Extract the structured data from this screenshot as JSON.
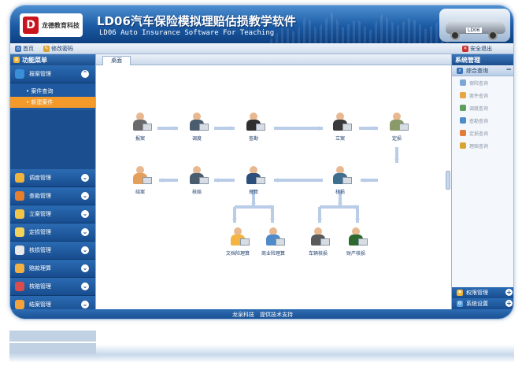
{
  "header": {
    "logo_text": "龙德教育科技",
    "title": "LD06汽车保险模拟理赔估损教学软件",
    "subtitle": "LD06 Auto Insurance Software For Teaching"
  },
  "topbar": {
    "home": "首页",
    "change_password": "修改密码",
    "logout": "安全退出"
  },
  "sidebar": {
    "header": "功能菜单",
    "expanded_group": {
      "label": "报案管理",
      "sub_items": [
        {
          "label": "案件查询",
          "active": false
        },
        {
          "label": "新建案件",
          "active": true
        }
      ]
    },
    "groups": [
      {
        "label": "调度管理",
        "icon": "dispatch-icon",
        "color": "#f0b43c"
      },
      {
        "label": "查勘管理",
        "icon": "survey-icon",
        "color": "#e6802e"
      },
      {
        "label": "立案管理",
        "icon": "filing-icon",
        "color": "#f3c64a"
      },
      {
        "label": "定损管理",
        "icon": "loss-icon",
        "color": "#f5d35a"
      },
      {
        "label": "核损管理",
        "icon": "verify-icon",
        "color": "#e9e9e9"
      },
      {
        "label": "赔款理算",
        "icon": "calc-icon",
        "color": "#f1b041"
      },
      {
        "label": "核赔管理",
        "icon": "review-icon",
        "color": "#d94d4d"
      },
      {
        "label": "结案管理",
        "icon": "close-case-icon",
        "color": "#f3a33a"
      },
      {
        "label": "保单管理",
        "icon": "policy-icon",
        "color": "#e57f2b"
      }
    ]
  },
  "main": {
    "tab": "桌面",
    "flow_nodes": {
      "report": "报案",
      "dispatch": "调度",
      "survey": "查勘",
      "filing": "立案",
      "loss": "定损",
      "verify": "核损",
      "calc": "理算",
      "review": "核赔",
      "close": "结案",
      "doc_calc": "文档险理算",
      "biz_calc": "商业险理算",
      "vehicle_loss": "车辆核损",
      "property_loss": "财产核损"
    }
  },
  "rightbar": {
    "header": "系统管理",
    "group": "综合查询",
    "items": [
      "保险查询",
      "案件查询",
      "调度查询",
      "查勘查询",
      "定损查询",
      "理赔查询"
    ],
    "bottom": [
      "权限管理",
      "系统设置"
    ]
  },
  "footer": "龙泉科技　提供技术支持",
  "colors": {
    "header_blue": "#1b5aa3",
    "sidebar_blue": "#1b4e8e",
    "active_orange": "#f39a2b"
  }
}
